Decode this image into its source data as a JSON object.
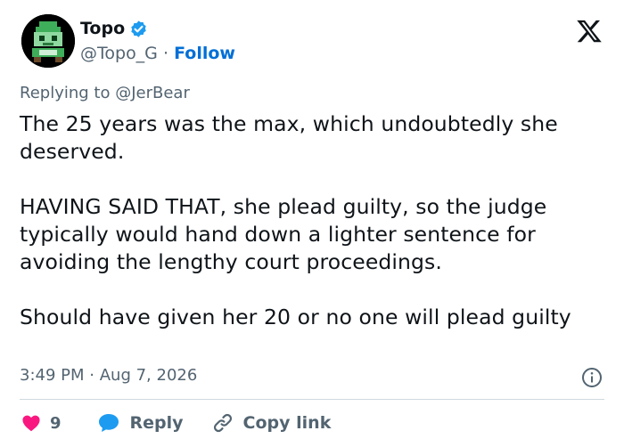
{
  "author": {
    "name": "Topo",
    "handle": "@Topo_G",
    "separator": "·",
    "follow_label": "Follow",
    "verified_color": "#1d9bf0"
  },
  "reply_to": {
    "prefix": "Replying to",
    "handle": "@JerBear"
  },
  "tweet": {
    "text": "The 25 years was the max, which undoubtedly she deserved.\n\nHAVING SAID THAT, she plead guilty, so the judge typically would hand down a lighter sentence for avoiding the lengthy court proceedings.\n\nShould have given her 20 or no one will plead guilty",
    "time": "3:49 PM",
    "date_separator": "·",
    "date": "Aug 7, 2026"
  },
  "actions": {
    "like_count": "9",
    "reply_label": "Reply",
    "copy_label": "Copy link"
  },
  "colors": {
    "like": "#f91880",
    "reply": "#1d9bf0",
    "link_text": "#006fd6",
    "muted": "#536471"
  },
  "icons": {
    "brand": "x-logo-icon",
    "verified": "verified-badge-icon",
    "info": "info-icon",
    "like": "heart-icon",
    "reply": "speech-bubble-icon",
    "copy": "link-icon"
  }
}
